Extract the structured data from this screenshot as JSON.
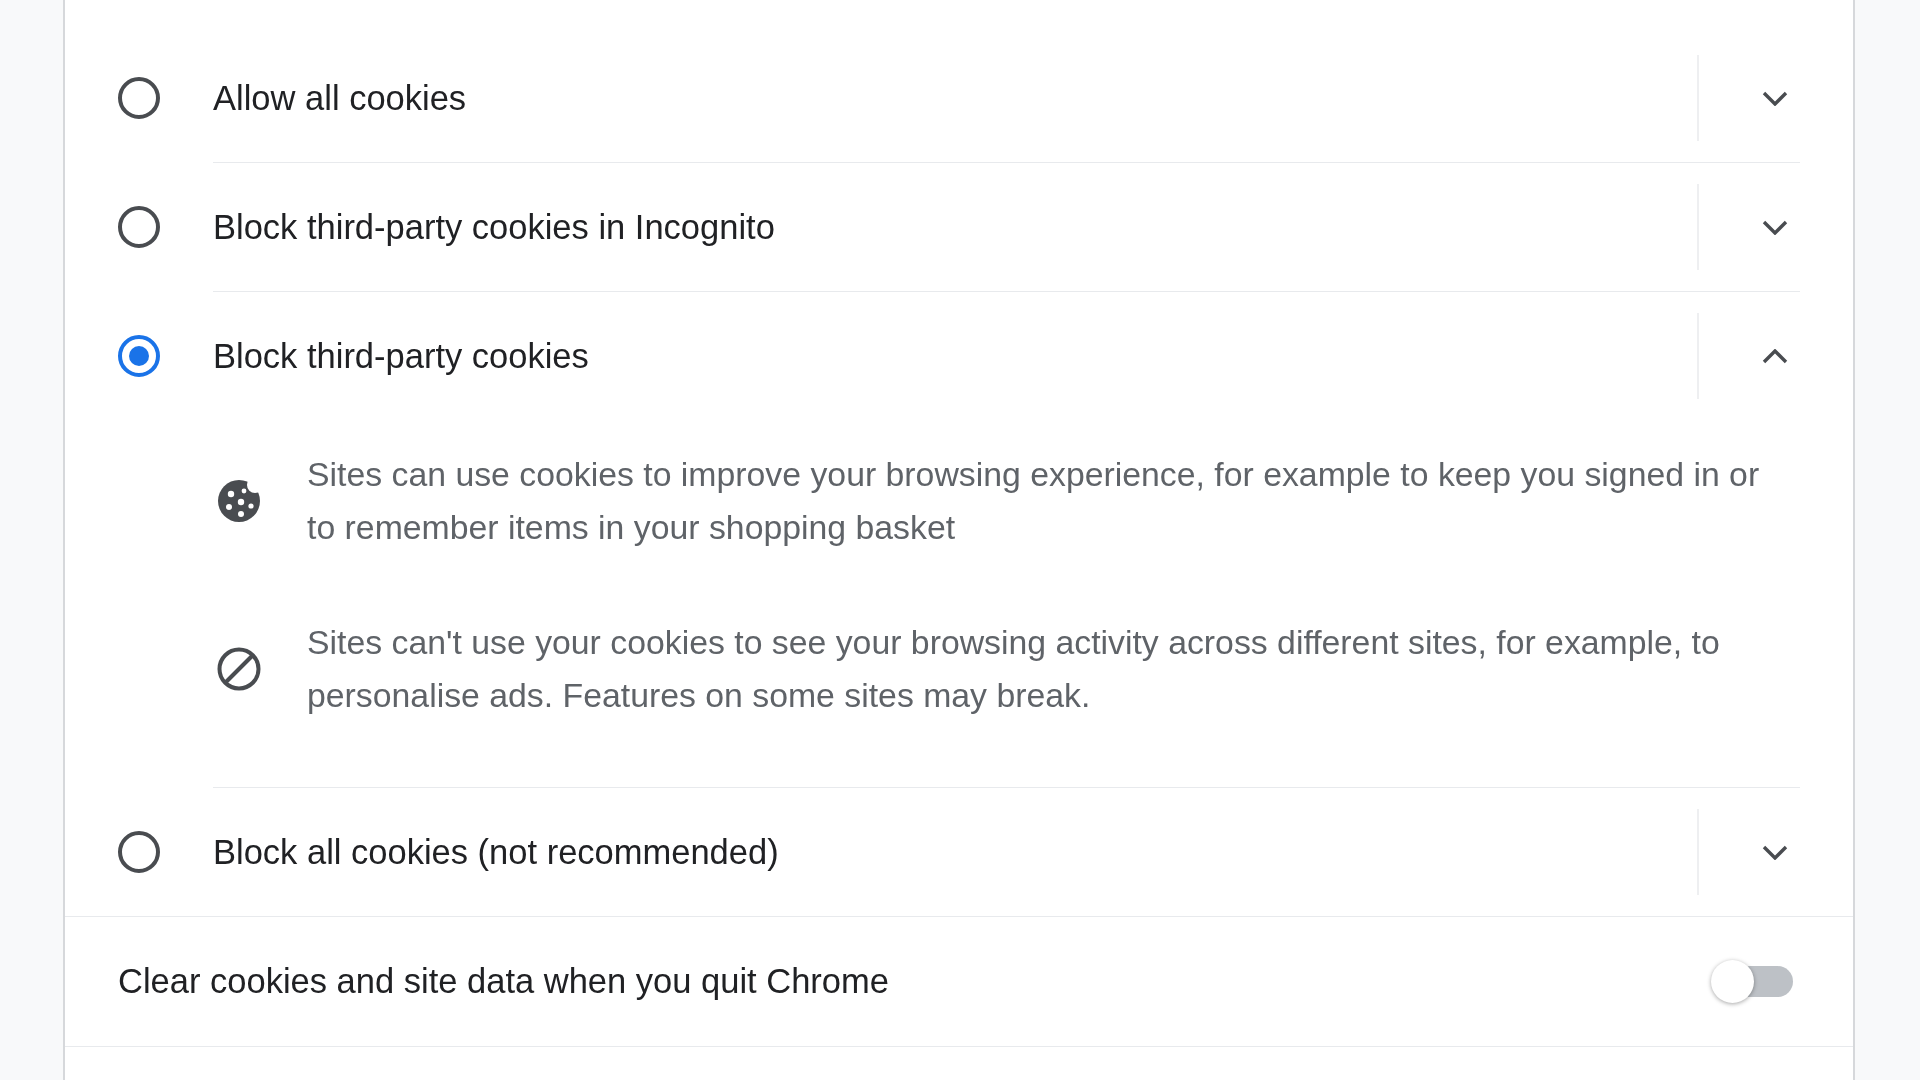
{
  "cookie_options": [
    {
      "label": "Allow all cookies",
      "selected": false,
      "expanded": false
    },
    {
      "label": "Block third-party cookies in Incognito",
      "selected": false,
      "expanded": false
    },
    {
      "label": "Block third-party cookies",
      "selected": true,
      "expanded": true,
      "details": [
        {
          "kind": "cookie",
          "text": "Sites can use cookies to improve your browsing experience, for example to keep you signed in or to remember items in your shopping basket"
        },
        {
          "kind": "blocked",
          "text": "Sites can't use your cookies to see your browsing activity across different sites, for example, to personalise ads. Features on some sites may break."
        }
      ]
    },
    {
      "label": "Block all cookies (not recommended)",
      "selected": false,
      "expanded": false
    }
  ],
  "clear_on_exit": {
    "label": "Clear cookies and site data when you quit Chrome",
    "on": false
  }
}
